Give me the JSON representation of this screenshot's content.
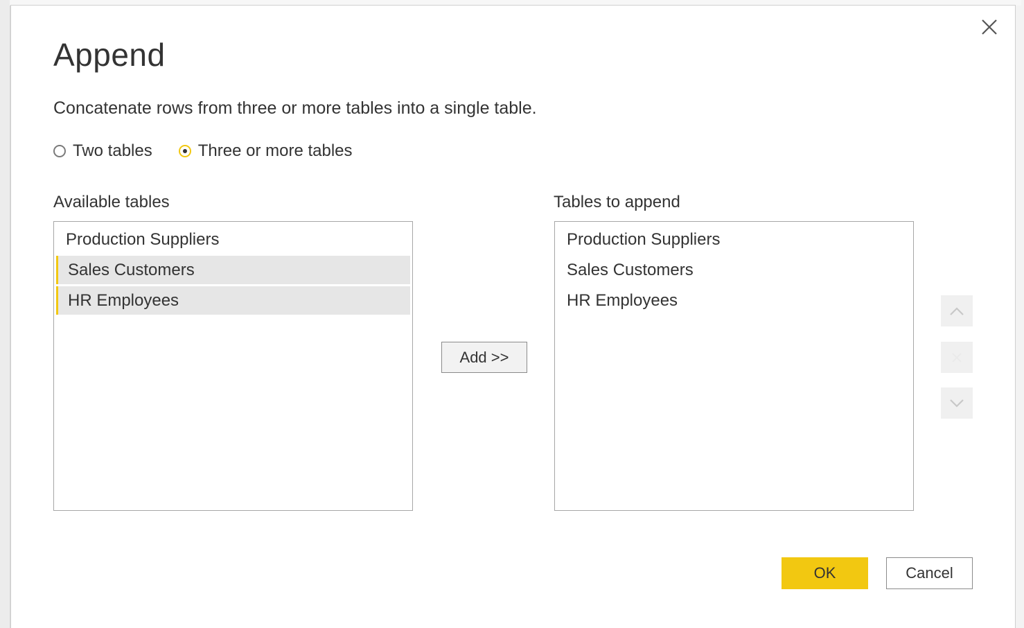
{
  "dialog": {
    "title": "Append",
    "description": "Concatenate rows from three or more tables into a single table.",
    "close_icon": "close-icon"
  },
  "mode": {
    "options": [
      {
        "label": "Two tables",
        "checked": false
      },
      {
        "label": "Three or more tables",
        "checked": true
      }
    ]
  },
  "available": {
    "label": "Available tables",
    "items": [
      {
        "label": "Production Suppliers",
        "selected": false
      },
      {
        "label": "Sales Customers",
        "selected": true
      },
      {
        "label": "HR Employees",
        "selected": true
      }
    ]
  },
  "add_button": {
    "label": "Add >>"
  },
  "append": {
    "label": "Tables to append",
    "items": [
      {
        "label": "Production Suppliers"
      },
      {
        "label": "Sales Customers"
      },
      {
        "label": "HR Employees"
      }
    ]
  },
  "order_controls": {
    "up_icon": "chevron-up-icon",
    "remove_icon": "remove-icon",
    "down_icon": "chevron-down-icon"
  },
  "footer": {
    "ok_label": "OK",
    "cancel_label": "Cancel"
  },
  "colors": {
    "accent": "#f2c811",
    "selection_bg": "#e6e6e6",
    "text": "#333333",
    "border": "#a6a6a6"
  }
}
